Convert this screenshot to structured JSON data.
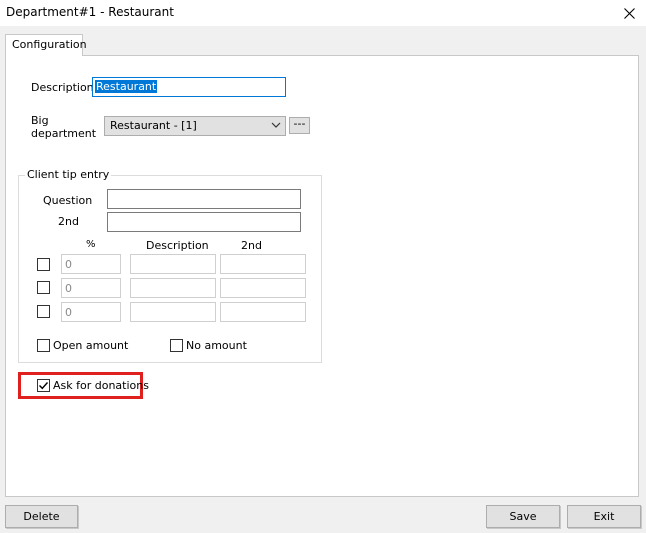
{
  "window": {
    "title": "Department#1 - Restaurant"
  },
  "icons": {
    "close": "close-icon",
    "dropdown": "chevron-down-icon",
    "check": "check-icon"
  },
  "tabs": [
    {
      "label": "Configuration",
      "active": true
    }
  ],
  "form": {
    "description": {
      "label": "Description",
      "value": "Restaurant"
    },
    "big_department": {
      "label_line1": "Big",
      "label_line2": "department",
      "selected": "Restaurant - [1]",
      "browse_label": "---"
    }
  },
  "client_tip_entry": {
    "title": "Client tip entry",
    "question_label": "Question",
    "second_label": "2nd",
    "question_value": "",
    "second_value": "",
    "columns": [
      "%",
      "Description",
      "2nd"
    ],
    "rows": [
      {
        "checked": false,
        "percent": "0",
        "description": "",
        "second": ""
      },
      {
        "checked": false,
        "percent": "0",
        "description": "",
        "second": ""
      },
      {
        "checked": false,
        "percent": "0",
        "description": "",
        "second": ""
      }
    ],
    "open_amount": {
      "label": "Open amount",
      "checked": false
    },
    "no_amount": {
      "label": "No amount",
      "checked": false
    }
  },
  "ask_for_donations": {
    "label": "Ask for donations",
    "checked": true
  },
  "highlight_color": "#e0201f",
  "buttons": {
    "delete": "Delete",
    "save": "Save",
    "exit": "Exit"
  }
}
